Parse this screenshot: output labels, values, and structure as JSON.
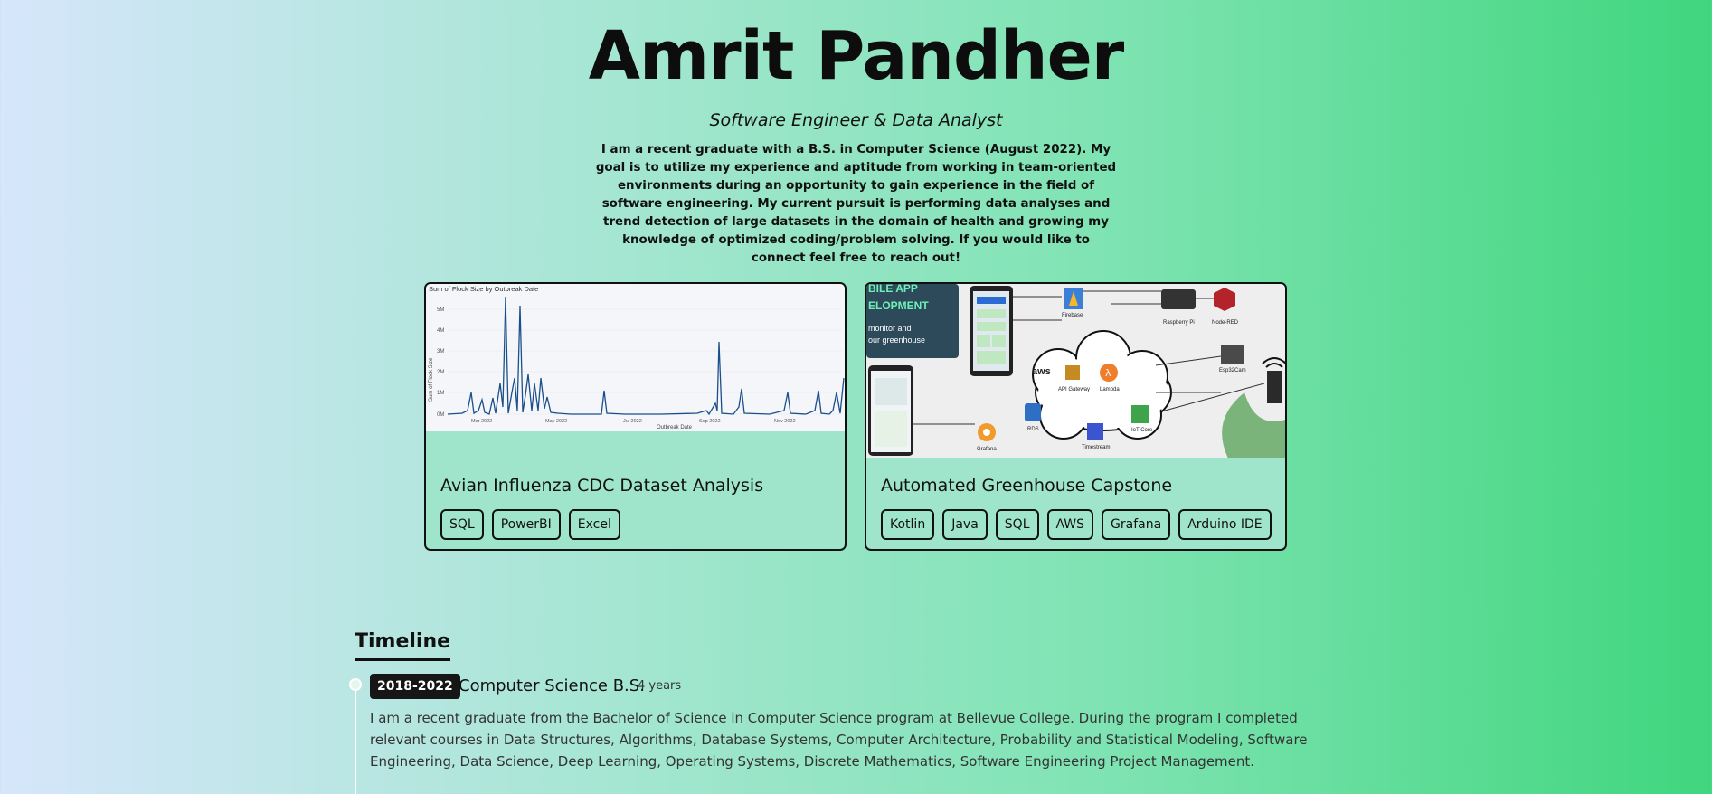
{
  "header": {
    "name": "Amrit Pandher",
    "subtitle": "Software Engineer & Data Analyst",
    "bio": "I am a recent graduate with a B.S. in Computer Science (August 2022). My goal is to utilize my experience and aptitude from working in team-oriented environments during an opportunity to gain experience in the field of software engineering. My current pursuit is performing data analyses and trend detection of large datasets in the domain of health and growing my knowledge of optimized coding/problem solving. If you would like to connect feel free to reach out!"
  },
  "projects": [
    {
      "title": "Avian Influenza CDC Dataset Analysis",
      "tags": [
        "SQL",
        "PowerBI",
        "Excel"
      ],
      "thumbnail": {
        "chart_title": "Sum of Flock Size by Outbreak Date",
        "ylabel": "Sum of Flock Size",
        "xlabel": "Outbreak Date",
        "yticks": [
          "5M",
          "4M",
          "3M",
          "2M",
          "1M",
          "0M"
        ],
        "xticks": [
          "Mar 2022",
          "May 2022",
          "Jul 2022",
          "Sep 2022",
          "Nov 2022"
        ]
      }
    },
    {
      "title": "Automated Greenhouse Capstone",
      "tags": [
        "Kotlin",
        "Java",
        "SQL",
        "AWS",
        "Grafana",
        "Arduino IDE"
      ],
      "thumbnail": {
        "banner_line1": "BILE APP",
        "banner_line2": "ELOPMENT",
        "banner_line3": "monitor and",
        "banner_line4": "our greenhouse",
        "labels": [
          "Firebase",
          "Raspberry Pi",
          "Node-RED",
          "Esp32Cam",
          "API Gateway",
          "Lambda",
          "RDS",
          "Timestream",
          "IoT Core",
          "Grafana"
        ],
        "aws_label": "aws"
      }
    }
  ],
  "timeline": {
    "title": "Timeline",
    "entries": [
      {
        "date": "2018-2022",
        "role": "Computer Science B.S.",
        "duration": "4 years",
        "description": "I am a recent graduate from the Bachelor of Science in Computer Science program at Bellevue College. During the program I completed relevant courses in Data Structures, Algorithms, Database Systems, Computer Architecture, Probability and Statistical Modeling, Software Engineering, Data Science, Deep Learning, Operating Systems, Discrete Mathematics, Software Engineering Project Management."
      }
    ]
  }
}
